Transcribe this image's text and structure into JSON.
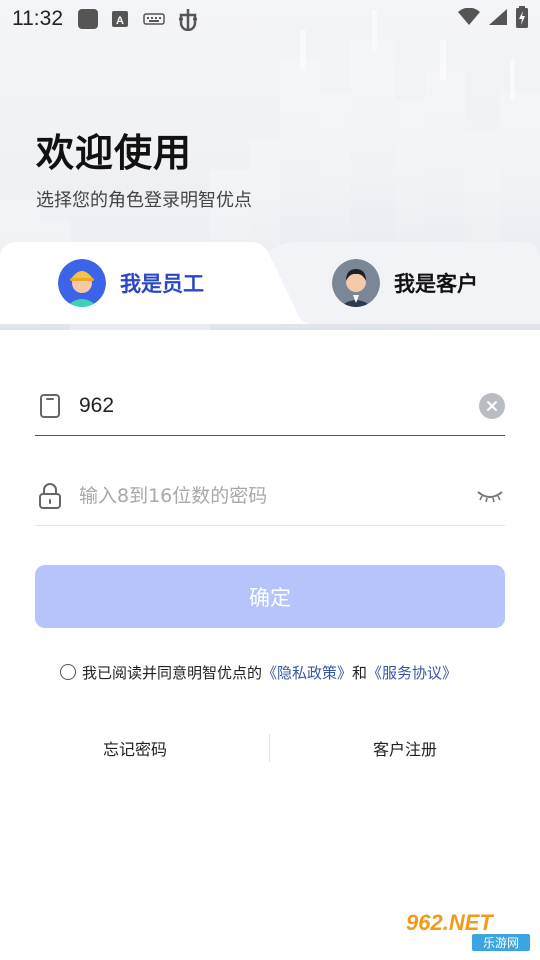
{
  "status_bar": {
    "time": "11:32",
    "icons": [
      "app-square-icon",
      "font-a-icon",
      "keyboard-icon",
      "bug-icon"
    ],
    "right_icons": [
      "wifi-icon",
      "signal-icon",
      "battery-charging-icon"
    ]
  },
  "header": {
    "title": "欢迎使用",
    "subtitle": "选择您的角色登录明智优点"
  },
  "tabs": [
    {
      "label": "我是员工",
      "active": true,
      "avatar": "worker-avatar"
    },
    {
      "label": "我是客户",
      "active": false,
      "avatar": "businessman-avatar"
    }
  ],
  "form": {
    "username": {
      "value": "962",
      "icon": "phone-icon",
      "action": "clear-icon"
    },
    "password": {
      "placeholder": "输入8到16位数的密码",
      "icon": "lock-icon",
      "action": "eye-closed-icon"
    },
    "confirm_label": "确定"
  },
  "agreement": {
    "prefix": "我已阅读并同意明智优点的",
    "privacy": "《隐私政策》",
    "and": "和",
    "service": "《服务协议》"
  },
  "links": {
    "forgot": "忘记密码",
    "register": "客户注册"
  },
  "watermark": {
    "top": "962.NET",
    "bottom": "乐游网"
  },
  "colors": {
    "primary": "#2a47c9",
    "button_disabled": "#b6c4fb",
    "link": "#3a55a8"
  }
}
